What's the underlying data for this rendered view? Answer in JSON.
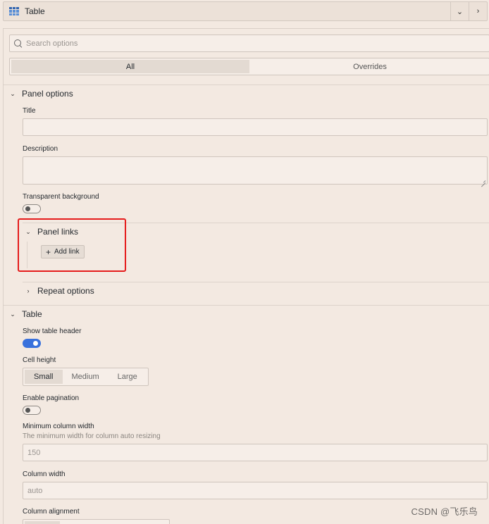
{
  "header": {
    "viz_title": "Table",
    "icons": {
      "viz": "table-icon",
      "dropdown": "chevron-down-icon",
      "collapse": "chevron-right-icon"
    }
  },
  "search": {
    "placeholder": "Search options",
    "value": ""
  },
  "tabs": [
    {
      "label": "All",
      "active": true
    },
    {
      "label": "Overrides",
      "active": false
    }
  ],
  "panel_options": {
    "header": "Panel options",
    "title_label": "Title",
    "title_value": "",
    "description_label": "Description",
    "description_value": "",
    "transparent_label": "Transparent background",
    "transparent_on": false,
    "links": {
      "header": "Panel links",
      "add_link_label": "Add link"
    },
    "repeat": {
      "header": "Repeat options"
    }
  },
  "table": {
    "header": "Table",
    "show_header_label": "Show table header",
    "show_header_on": true,
    "cell_height_label": "Cell height",
    "cell_height_options": [
      "Small",
      "Medium",
      "Large"
    ],
    "cell_height_selected": "Small",
    "pagination_label": "Enable pagination",
    "pagination_on": false,
    "min_col_width_label": "Minimum column width",
    "min_col_width_desc": "The minimum width for column auto resizing",
    "min_col_width_placeholder": "150",
    "col_width_label": "Column width",
    "col_width_placeholder": "auto",
    "col_alignment_label": "Column alignment"
  },
  "watermark": "CSDN @飞乐鸟",
  "colors": {
    "accent": "#3871dc",
    "highlight": "#e51c1c",
    "background": "#f3e9e1"
  }
}
